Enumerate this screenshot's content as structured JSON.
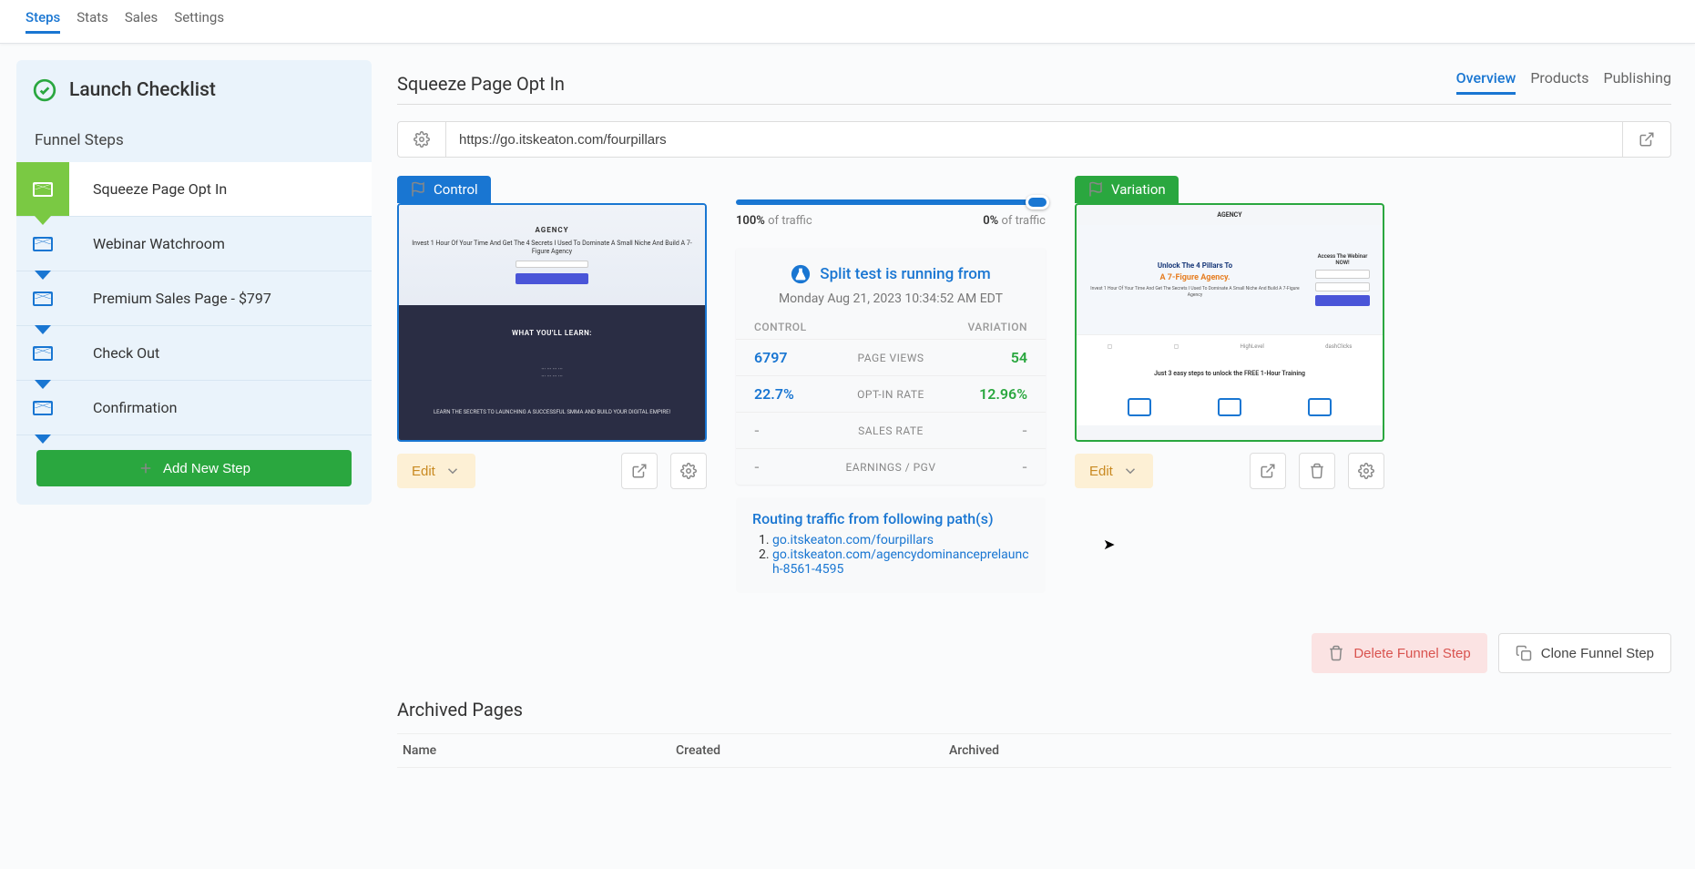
{
  "topTabs": {
    "steps": "Steps",
    "stats": "Stats",
    "sales": "Sales",
    "settings": "Settings"
  },
  "sidebar": {
    "launch_header": "Launch Checklist",
    "funnel_steps_header": "Funnel Steps",
    "steps": [
      {
        "label": "Squeeze Page Opt In"
      },
      {
        "label": "Webinar Watchroom"
      },
      {
        "label": "Premium Sales Page - $797"
      },
      {
        "label": "Check Out"
      },
      {
        "label": "Confirmation"
      }
    ],
    "add_step": "Add New Step"
  },
  "page": {
    "title": "Squeeze Page Opt In",
    "subtabs": {
      "overview": "Overview",
      "products": "Products",
      "publishing": "Publishing"
    },
    "url": "https://go.itskeaton.com/fourpillars"
  },
  "variants": {
    "control_label": "Control",
    "variation_label": "Variation",
    "edit": "Edit",
    "preview_control": {
      "logo": "AGENCY",
      "headline": "Invest 1 Hour Of Your Time And Get The 4 Secrets I Used To Dominate A Small Niche And Build A 7-Figure Agency",
      "section1": "WHAT YOU'LL LEARN:",
      "section2": "LEARN THE SECRETS TO LAUNCHING A SUCCESSFUL SMMA AND BUILD YOUR DIGITAL EMPIRE!"
    },
    "preview_variation": {
      "logo": "AGENCY",
      "h1": "Unlock The 4 Pillars To",
      "h2": "A 7-Figure Agency.",
      "access": "Access The Webinar NOW!",
      "sub": "Invest 1 Hour Of Your Time And Get The Secrets I Used To Dominate A Small Niche And Build A 7-Figure Agency",
      "bottom": "Just 3 easy steps to unlock the FREE 1-Hour Training"
    }
  },
  "split": {
    "left_pct": "100%",
    "left_lbl": "of traffic",
    "right_pct": "0%",
    "right_lbl": "of traffic",
    "stats_title": "Split test is running from",
    "stats_date": "Monday Aug 21, 2023 10:34:52 AM EDT",
    "hdr_control": "CONTROL",
    "hdr_variation": "VARIATION",
    "rows": [
      {
        "l": "6797",
        "m": "PAGE VIEWS",
        "r": "54"
      },
      {
        "l": "22.7%",
        "m": "OPT-IN RATE",
        "r": "12.96%"
      },
      {
        "l": "-",
        "m": "SALES RATE",
        "r": "-"
      },
      {
        "l": "-",
        "m": "EARNINGS / PGV",
        "r": "-"
      }
    ],
    "routing_title": "Routing traffic from following path(s)",
    "routes": [
      "go.itskeaton.com/fourpillars",
      "go.itskeaton.com/agencydominanceprelaunch-8561-4595"
    ]
  },
  "footer": {
    "delete": "Delete Funnel Step",
    "clone": "Clone Funnel Step"
  },
  "archived": {
    "title": "Archived Pages",
    "name": "Name",
    "created": "Created",
    "archived": "Archived"
  }
}
